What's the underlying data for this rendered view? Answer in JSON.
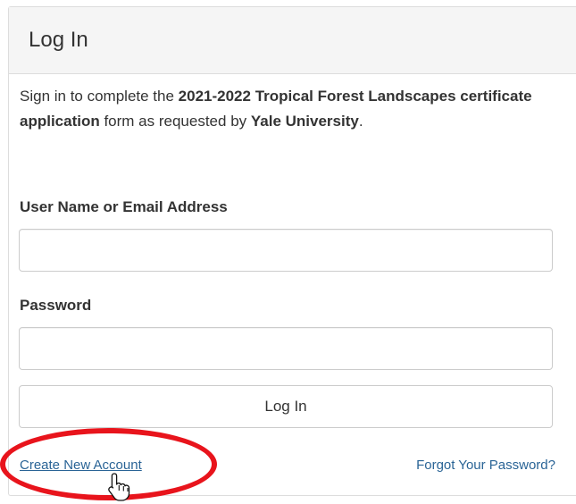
{
  "panel": {
    "title": "Log In"
  },
  "intro": {
    "part1": "Sign in to complete the ",
    "program": "2021-2022 Tropical Forest Landscapes certificate application",
    "part2": " form as requested by ",
    "institution": "Yale University",
    "part3": "."
  },
  "form": {
    "username_label": "User Name or Email Address",
    "username_value": "",
    "password_label": "Password",
    "password_value": "",
    "submit_label": "Log In"
  },
  "links": {
    "create_account": "Create New Account",
    "forgot_password": "Forgot Your Password?"
  },
  "colors": {
    "link": "#2a6496",
    "highlight": "#e8141c",
    "header_bg": "#f5f5f5"
  },
  "icons": {
    "cursor": "hand-pointer-icon"
  }
}
